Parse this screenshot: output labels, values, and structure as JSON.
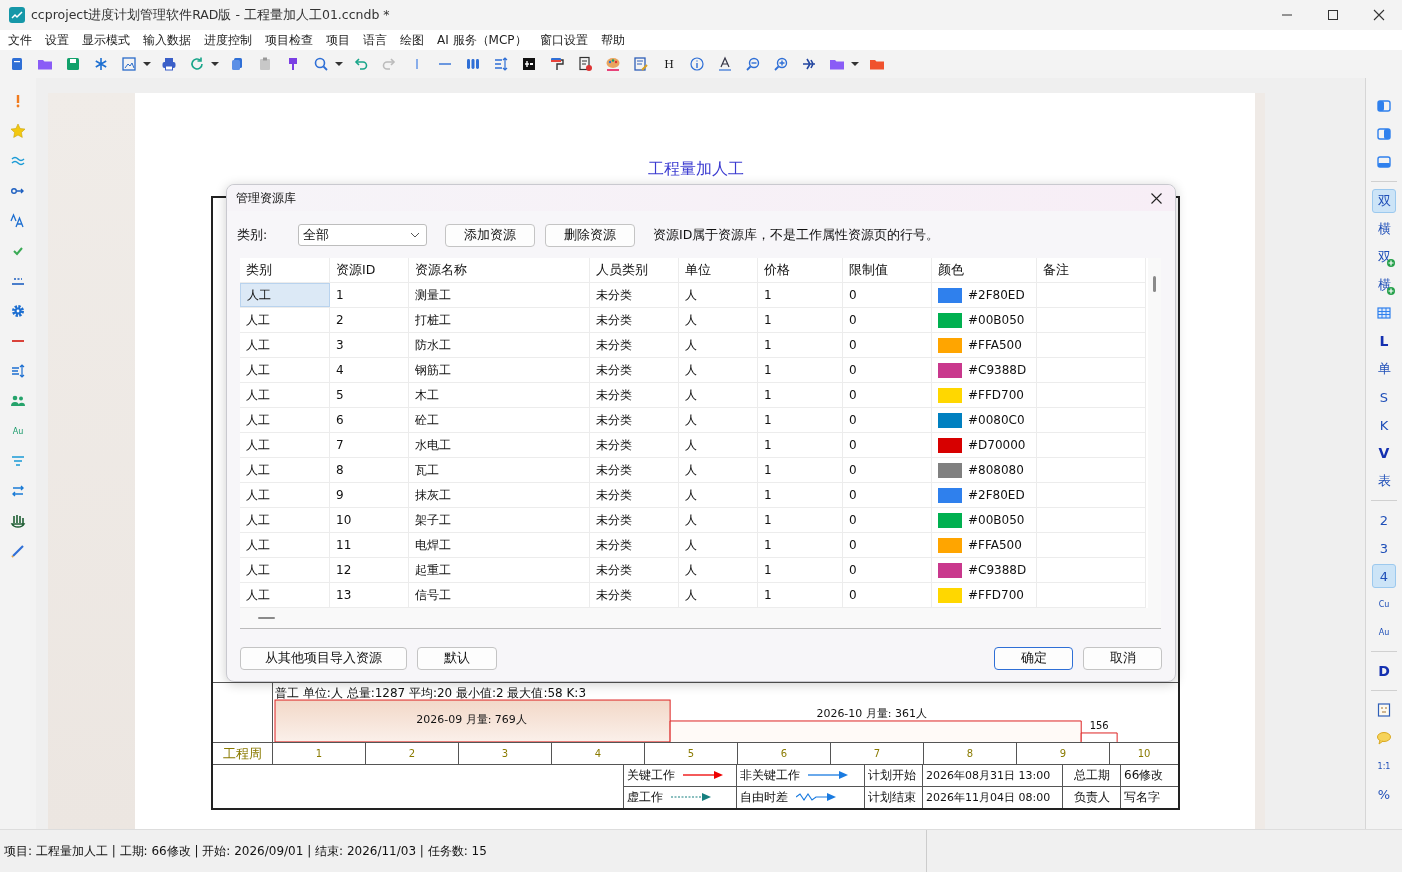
{
  "window": {
    "title": "ccproject进度计划管理软件RAD版 - 工程量加人工01.ccndb *"
  },
  "menu": [
    "文件",
    "设置",
    "显示模式",
    "输入数据",
    "进度控制",
    "项目检查",
    "项目",
    "语言",
    "绘图",
    "AI 服务（MCP）",
    "窗口设置",
    "帮助"
  ],
  "toolbar": [
    {
      "kind": "icon"
    },
    {
      "kind": "icon"
    },
    {
      "kind": "icon"
    },
    {
      "kind": "icon"
    },
    {
      "kind": "icon"
    },
    {
      "kind": "dropdown"
    },
    {
      "kind": "icon"
    },
    {
      "kind": "icon"
    },
    {
      "kind": "dropdown"
    },
    {
      "kind": "icon"
    },
    {
      "kind": "icon"
    },
    {
      "kind": "icon"
    },
    {
      "kind": "icon"
    },
    {
      "kind": "dropdown"
    },
    {
      "kind": "icon"
    },
    {
      "kind": "icon"
    },
    {
      "kind": "icon"
    },
    {
      "kind": "icon"
    },
    {
      "kind": "icon"
    },
    {
      "kind": "icon"
    },
    {
      "kind": "icon"
    },
    {
      "kind": "icon"
    },
    {
      "kind": "icon"
    },
    {
      "kind": "icon"
    },
    {
      "kind": "icon"
    },
    {
      "kind": "text",
      "label": "H"
    },
    {
      "kind": "icon"
    },
    {
      "kind": "icon"
    },
    {
      "kind": "icon"
    },
    {
      "kind": "icon"
    },
    {
      "kind": "icon"
    },
    {
      "kind": "icon"
    },
    {
      "kind": "dropdown"
    },
    {
      "kind": "icon"
    }
  ],
  "left_toolbar": [
    {
      "kind": "icon"
    },
    {
      "kind": "icon"
    },
    {
      "kind": "icon"
    },
    {
      "kind": "icon"
    },
    {
      "kind": "icon"
    },
    {
      "kind": "icon"
    },
    {
      "kind": "icon"
    },
    {
      "kind": "icon"
    },
    {
      "kind": "icon"
    },
    {
      "kind": "icon"
    },
    {
      "kind": "icon"
    },
    {
      "kind": "text",
      "label": "Au"
    },
    {
      "kind": "icon"
    },
    {
      "kind": "icon"
    },
    {
      "kind": "icon"
    },
    {
      "kind": "icon"
    }
  ],
  "right_toolbar": [
    {
      "kind": "icon"
    },
    {
      "kind": "icon"
    },
    {
      "kind": "icon"
    },
    {
      "kind": "separator"
    },
    {
      "kind": "text",
      "label": "双",
      "selected": true
    },
    {
      "kind": "text",
      "label": "横",
      "selected": false
    },
    {
      "kind": "text-add",
      "label": "双",
      "selected": false
    },
    {
      "kind": "text-add",
      "label": "横",
      "selected": false
    },
    {
      "kind": "icon"
    },
    {
      "kind": "bold-text",
      "label": "L",
      "selected": false
    },
    {
      "kind": "text",
      "label": "单",
      "selected": false
    },
    {
      "kind": "text",
      "label": "S",
      "selected": false
    },
    {
      "kind": "text",
      "label": "K",
      "selected": false
    },
    {
      "kind": "bold-text",
      "label": "V",
      "selected": false
    },
    {
      "kind": "text",
      "label": "表",
      "selected": false
    },
    {
      "kind": "separator"
    },
    {
      "kind": "text",
      "label": "2",
      "selected": false
    },
    {
      "kind": "text",
      "label": "3",
      "selected": false
    },
    {
      "kind": "text",
      "label": "4",
      "selected": true
    },
    {
      "kind": "small-text",
      "label": "Cu",
      "selected": false
    },
    {
      "kind": "small-text",
      "label": "Au",
      "selected": false
    },
    {
      "kind": "separator"
    },
    {
      "kind": "bold-text",
      "label": "D",
      "selected": false
    },
    {
      "kind": "separator"
    },
    {
      "kind": "icon"
    },
    {
      "kind": "icon"
    },
    {
      "kind": "small-text",
      "label": "1:1",
      "selected": false
    },
    {
      "kind": "text",
      "label": "%",
      "selected": false
    }
  ],
  "document": {
    "title": "工程量加人工",
    "histogram": {
      "summary": "普工 单位:人 总量:1287 平均:20 最小值:2 最大值:58 K:3",
      "bars": [
        {
          "label": "2026-09 月量: 769人"
        },
        {
          "label": "2026-10 月量: 361人"
        },
        {
          "label": "156"
        }
      ]
    },
    "week_row": {
      "header": "工程周",
      "weeks": [
        "1",
        "2",
        "3",
        "4",
        "5",
        "6",
        "7",
        "8",
        "9",
        "10"
      ]
    },
    "legend": {
      "critical": "关键工作",
      "non_critical": "非关键工作",
      "plan_start_label": "计划开始",
      "plan_start": "2026年08月31日  13:00",
      "duration_label": "总工期",
      "duration": "66修改",
      "dummy": "虚工作",
      "free_float": "自由时差",
      "plan_end_label": "计划结束",
      "plan_end": "2026年11月04日  08:00",
      "owner_label": "负责人",
      "owner": "写名字"
    }
  },
  "dialog": {
    "title": "管理资源库",
    "category_label": "类别:",
    "category": "全部",
    "add_button": "添加资源",
    "delete_button": "删除资源",
    "note": "资源ID属于资源库，不是工作属性资源页的行号。",
    "columns": [
      "类别",
      "资源ID",
      "资源名称",
      "人员类别",
      "单位",
      "价格",
      "限制值",
      "颜色",
      "备注"
    ],
    "rows": [
      {
        "category": "人工",
        "id": "1",
        "name": "测量工",
        "staff_type": "未分类",
        "unit": "人",
        "price": "1",
        "limit": "0",
        "color_text": "#2F80ED",
        "color": "#2f80ed",
        "selected": true
      },
      {
        "category": "人工",
        "id": "2",
        "name": "打桩工",
        "staff_type": "未分类",
        "unit": "人",
        "price": "1",
        "limit": "0",
        "color_text": "#00B050",
        "color": "#00b050",
        "selected": false
      },
      {
        "category": "人工",
        "id": "3",
        "name": "防水工",
        "staff_type": "未分类",
        "unit": "人",
        "price": "1",
        "limit": "0",
        "color_text": "#FFA500",
        "color": "#ffa500",
        "selected": false
      },
      {
        "category": "人工",
        "id": "4",
        "name": "钢筋工",
        "staff_type": "未分类",
        "unit": "人",
        "price": "1",
        "limit": "0",
        "color_text": "#C9388D",
        "color": "#c9388d",
        "selected": false
      },
      {
        "category": "人工",
        "id": "5",
        "name": "木工",
        "staff_type": "未分类",
        "unit": "人",
        "price": "1",
        "limit": "0",
        "color_text": "#FFD700",
        "color": "#ffd700",
        "selected": false
      },
      {
        "category": "人工",
        "id": "6",
        "name": "砼工",
        "staff_type": "未分类",
        "unit": "人",
        "price": "1",
        "limit": "0",
        "color_text": "#0080C0",
        "color": "#0080c0",
        "selected": false
      },
      {
        "category": "人工",
        "id": "7",
        "name": "水电工",
        "staff_type": "未分类",
        "unit": "人",
        "price": "1",
        "limit": "0",
        "color_text": "#D70000",
        "color": "#d70000",
        "selected": false
      },
      {
        "category": "人工",
        "id": "8",
        "name": "瓦工",
        "staff_type": "未分类",
        "unit": "人",
        "price": "1",
        "limit": "0",
        "color_text": "#808080",
        "color": "#808080",
        "selected": false
      },
      {
        "category": "人工",
        "id": "9",
        "name": "抹灰工",
        "staff_type": "未分类",
        "unit": "人",
        "price": "1",
        "limit": "0",
        "color_text": "#2F80ED",
        "color": "#2f80ed",
        "selected": false
      },
      {
        "category": "人工",
        "id": "10",
        "name": "架子工",
        "staff_type": "未分类",
        "unit": "人",
        "price": "1",
        "limit": "0",
        "color_text": "#00B050",
        "color": "#00b050",
        "selected": false
      },
      {
        "category": "人工",
        "id": "11",
        "name": "电焊工",
        "staff_type": "未分类",
        "unit": "人",
        "price": "1",
        "limit": "0",
        "color_text": "#FFA500",
        "color": "#ffa500",
        "selected": false
      },
      {
        "category": "人工",
        "id": "12",
        "name": "起重工",
        "staff_type": "未分类",
        "unit": "人",
        "price": "1",
        "limit": "0",
        "color_text": "#C9388D",
        "color": "#c9388d",
        "selected": false
      },
      {
        "category": "人工",
        "id": "13",
        "name": "信号工",
        "staff_type": "未分类",
        "unit": "人",
        "price": "1",
        "limit": "0",
        "color_text": "#FFD700",
        "color": "#ffd700",
        "selected": false
      }
    ],
    "import_button": "从其他项目导入资源",
    "default_button": "默认",
    "ok_button": "确定",
    "cancel_button": "取消"
  },
  "status_bar": "项目: 工程量加人工 | 工期: 66修改 | 开始: 2026/09/01 | 结束: 2026/11/03 | 任务数: 15"
}
